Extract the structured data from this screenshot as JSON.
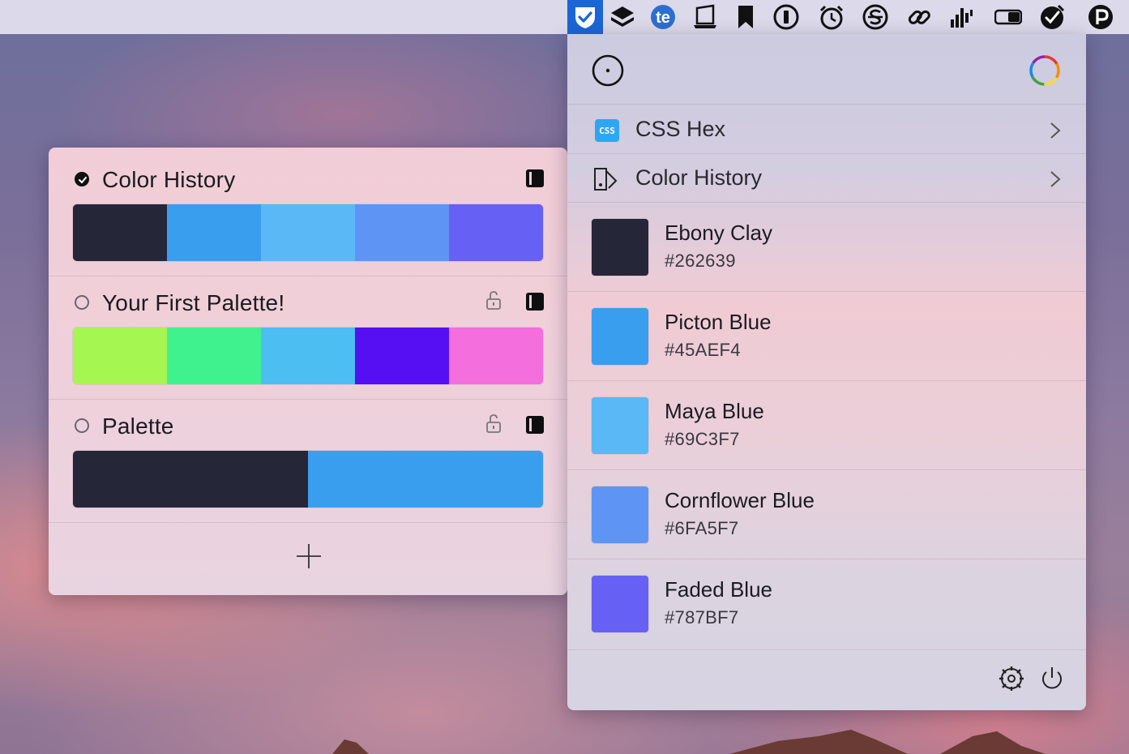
{
  "menubar": {
    "icons": [
      "checkmark-shield-icon",
      "stack-icon",
      "te-icon",
      "laptop-icon",
      "bookmark-icon",
      "1password-icon",
      "alarm-clock-icon",
      "s-circle-icon",
      "link-icon",
      "signal-bars-icon",
      "toggle-icon",
      "colorsnapper-icon",
      "p-circle-icon"
    ],
    "active_icon": "checkmark-shield-icon"
  },
  "palettes_panel": {
    "palettes": [
      {
        "title": "Color History",
        "selected": true,
        "locked": null,
        "colors": [
          "#262639",
          "#3A9EEE",
          "#5AB8F6",
          "#5E95F4",
          "#6660F4"
        ]
      },
      {
        "title": "Your First Palette!",
        "selected": false,
        "locked": false,
        "colors": [
          "#A6F652",
          "#40F28E",
          "#4CBEF2",
          "#560EF2",
          "#F46EDE"
        ]
      },
      {
        "title": "Palette",
        "selected": false,
        "locked": false,
        "colors": [
          "#262639",
          "#3A9EEE"
        ]
      }
    ],
    "add_button": "add-palette"
  },
  "menu_panel": {
    "format_label": "CSS Hex",
    "format_badge": "CSS",
    "history_label": "Color History",
    "colors": [
      {
        "name": "Ebony Clay",
        "hex": "#262639",
        "swatch": "#262639"
      },
      {
        "name": "Picton Blue",
        "hex": "#45AEF4",
        "swatch": "#3A9EEE"
      },
      {
        "name": "Maya Blue",
        "hex": "#69C3F7",
        "swatch": "#5AB8F6"
      },
      {
        "name": "Cornflower Blue",
        "hex": "#6FA5F7",
        "swatch": "#5E95F4"
      },
      {
        "name": "Faded Blue",
        "hex": "#787BF7",
        "swatch": "#6660F4"
      }
    ]
  }
}
